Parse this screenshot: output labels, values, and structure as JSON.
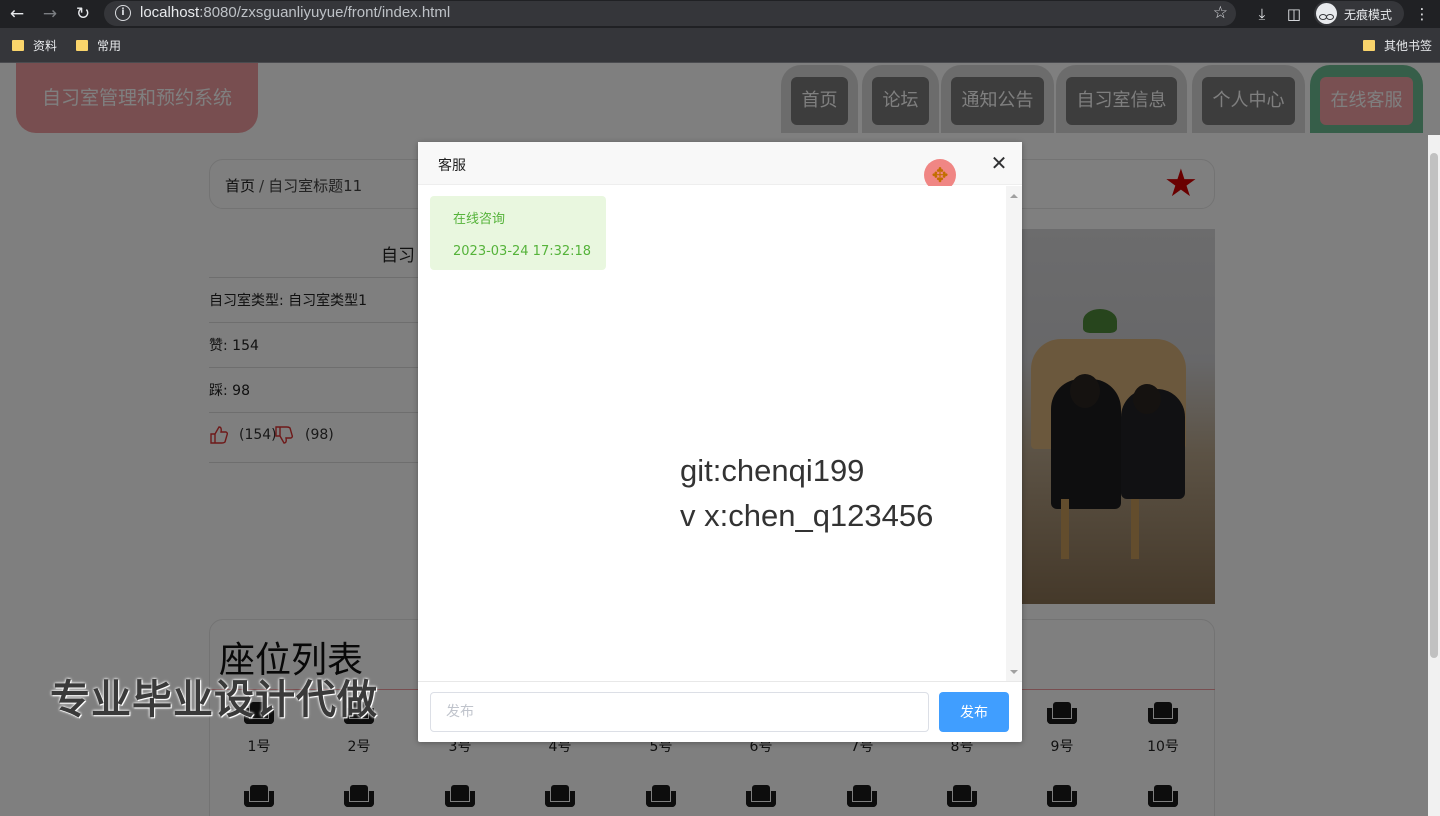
{
  "browser": {
    "url_host": "localhost",
    "url_rest": ":8080/zxsguanliyuyue/front/index.html",
    "incognito_label": "无痕模式",
    "bookmarks": [
      "资料",
      "常用"
    ],
    "other_bookmarks": "其他书签"
  },
  "site": {
    "logo": "自习室管理和预约系统",
    "nav": [
      "首页",
      "论坛",
      "通知公告",
      "自习室信息",
      "个人中心",
      "在线客服"
    ],
    "active_nav": "在线客服"
  },
  "breadcrumb": {
    "home": "首页",
    "separator": "/",
    "current": "自习室标题11"
  },
  "detail": {
    "title_partial": "自习",
    "type_row": "自习室类型: 自习室类型1",
    "likes_row": "赞: 154",
    "dislikes_row": "踩: 98",
    "likes_count": "(154)",
    "dislikes_count": "(98)"
  },
  "seats": {
    "heading": "座位列表",
    "labels": [
      "1号",
      "2号",
      "3号",
      "4号",
      "5号",
      "6号",
      "7号",
      "8号",
      "9号",
      "10号"
    ]
  },
  "watermark": "专业毕业设计代做",
  "dialog": {
    "title": "客服",
    "close_icon": "close-icon",
    "message": {
      "text": "在线咨询",
      "time": "2023-03-24 17:32:18"
    },
    "promo_line1": "git:chenqi199",
    "promo_line2": "v x:chen_q123456",
    "input_placeholder": "发布",
    "send_label": "发布"
  },
  "colors": {
    "logo": "#f19ca0",
    "nav_tab": "#7a7a7a",
    "nav_active_ring": "#6dbd92",
    "star": "#d40000",
    "send_button": "#409eff",
    "bubble_bg": "#e9f7df",
    "bubble_text": "#55b33a"
  }
}
